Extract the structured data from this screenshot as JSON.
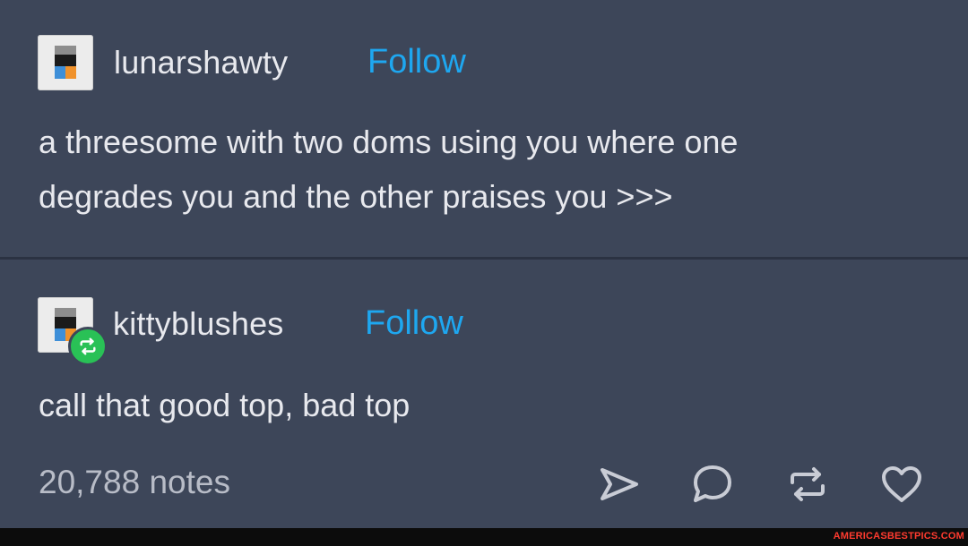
{
  "post1": {
    "username": "lunarshawty",
    "follow_label": "Follow",
    "line1": "a threesome with two doms using you where one",
    "line2": "degrades you and the other praises you >>>"
  },
  "post2": {
    "username": "kittyblushes",
    "follow_label": "Follow",
    "text": "call that good top, bad top",
    "notes": "20,788 notes"
  },
  "actions": {
    "icons": [
      "send-icon",
      "comment-icon",
      "reblog-icon",
      "like-heart-icon"
    ]
  },
  "colors": {
    "background": "#3d4659",
    "follow": "#1ea7f0",
    "reblog_badge": "#29c156",
    "text": "#e8e9ee"
  },
  "watermark": "AMERICASBESTPICS.COM"
}
